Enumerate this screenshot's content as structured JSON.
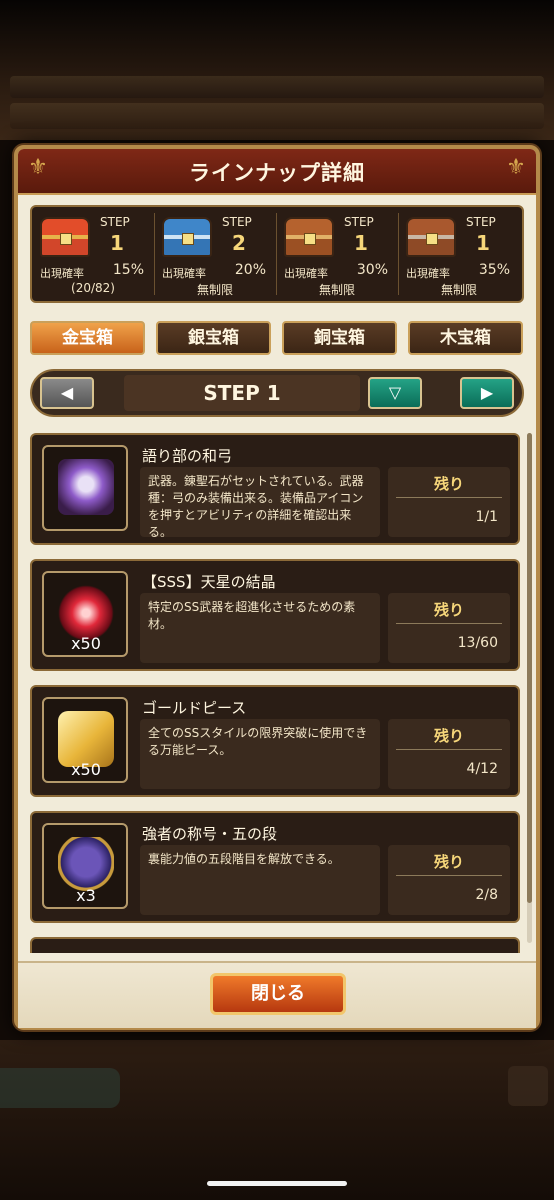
{
  "modal": {
    "title": "ラインナップ詳細"
  },
  "steps": [
    {
      "step_label": "STEP",
      "step_num": "1",
      "rate_label": "出現確率",
      "rate": "15%",
      "limit": "(20/82)",
      "chest": "gold-chest-icon"
    },
    {
      "step_label": "STEP",
      "step_num": "2",
      "rate_label": "出現確率",
      "rate": "20%",
      "limit": "無制限",
      "chest": "silver-chest-icon"
    },
    {
      "step_label": "STEP",
      "step_num": "1",
      "rate_label": "出現確率",
      "rate": "30%",
      "limit": "無制限",
      "chest": "bronze-chest-icon"
    },
    {
      "step_label": "STEP",
      "step_num": "1",
      "rate_label": "出現確率",
      "rate": "35%",
      "limit": "無制限",
      "chest": "wood-chest-icon"
    }
  ],
  "tabs": [
    "金宝箱",
    "銀宝箱",
    "銅宝箱",
    "木宝箱"
  ],
  "active_tab": "金宝箱",
  "step_nav": {
    "title": "STEP 1",
    "prev": "◀",
    "next": "▶",
    "down": "▽"
  },
  "items": [
    {
      "name": "語り部の和弓",
      "desc": "武器。錬聖石がセットされている。武器種：弓のみ装備出来る。装備品アイコンを押すとアビリティの詳細を確認出来る。",
      "remain_label": "残り",
      "remain": "1/1",
      "qty": "",
      "icon": "bow-weapon-icon"
    },
    {
      "name": "【SSS】天星の結晶",
      "desc": "特定のSS武器を超進化させるための素材。",
      "remain_label": "残り",
      "remain": "13/60",
      "qty": "x50",
      "icon": "red-crystal-icon"
    },
    {
      "name": "ゴールドピース",
      "desc": "全てのSSスタイルの限界突破に使用できる万能ピース。",
      "remain_label": "残り",
      "remain": "4/12",
      "qty": "x50",
      "icon": "gold-piece-icon"
    },
    {
      "name": "強者の称号・五の段",
      "desc": "裏能力値の五段階目を解放できる。",
      "remain_label": "残り",
      "remain": "2/8",
      "qty": "x3",
      "icon": "emblem-five-icon"
    }
  ],
  "footer": {
    "close_label": "閉じる"
  }
}
